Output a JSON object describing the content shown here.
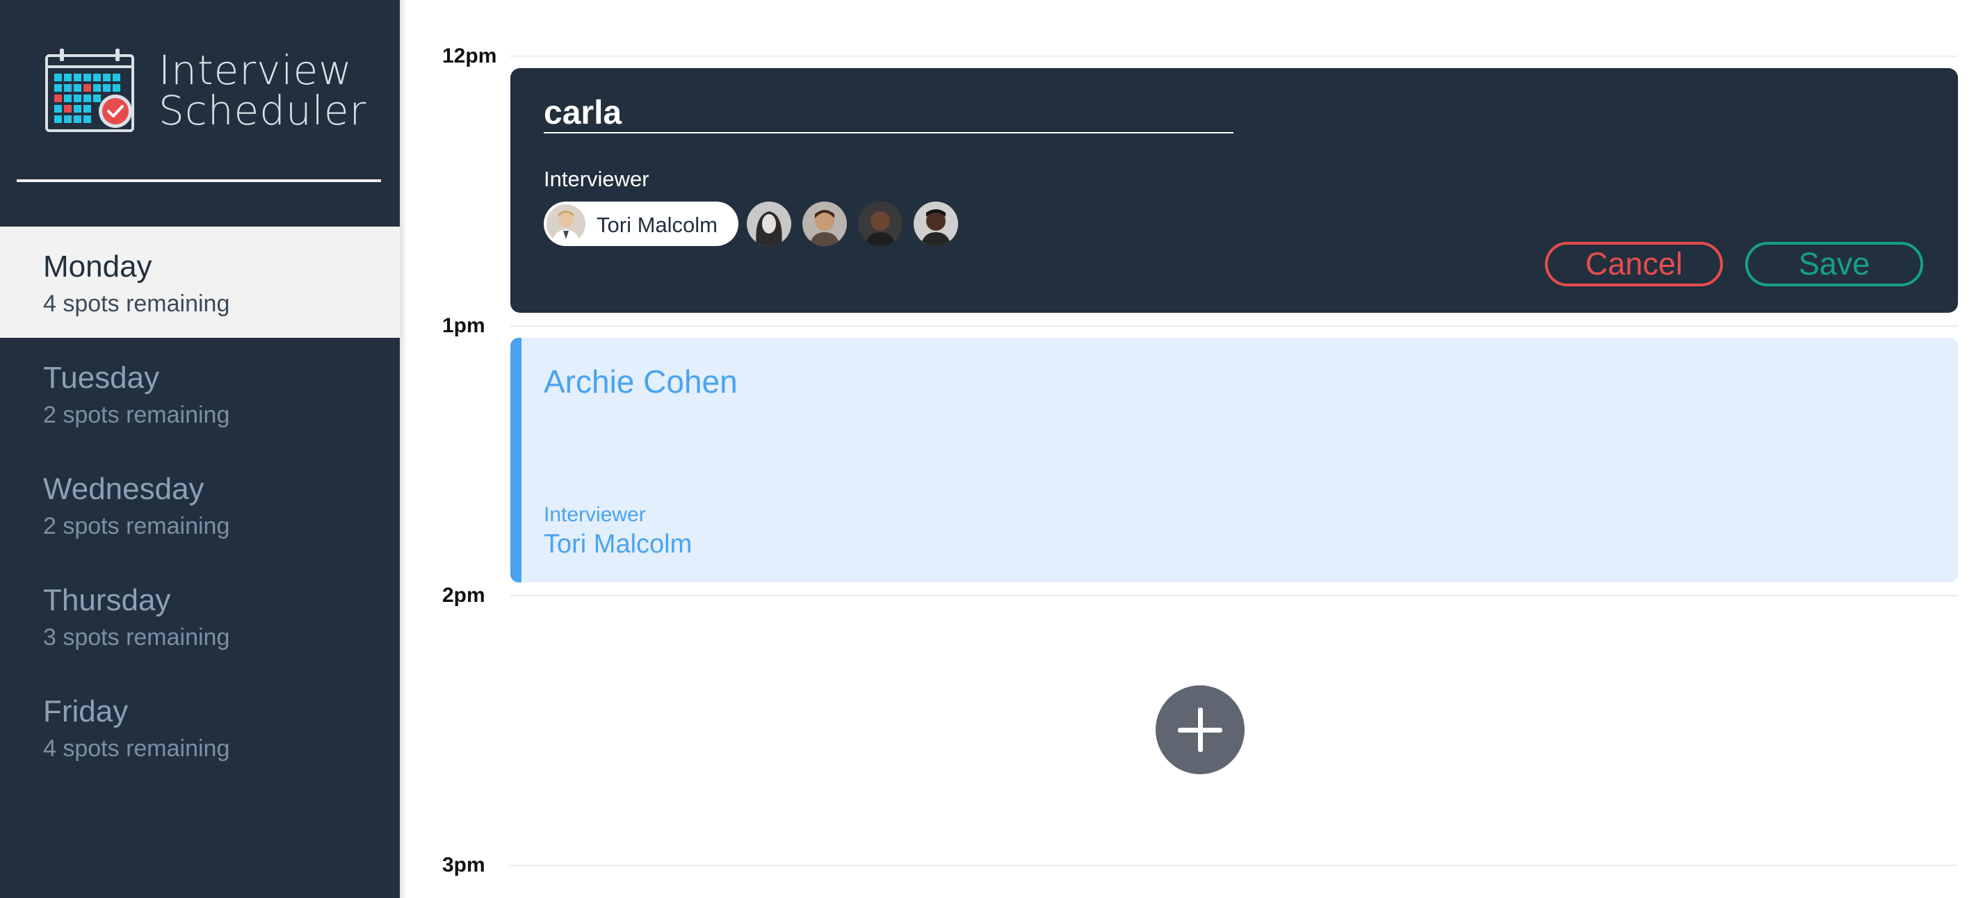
{
  "app": {
    "title_line1": "Interview",
    "title_line2": "Scheduler"
  },
  "sidebar": {
    "days": [
      {
        "name": "Monday",
        "spots": "4 spots remaining",
        "selected": true
      },
      {
        "name": "Tuesday",
        "spots": "2 spots remaining"
      },
      {
        "name": "Wednesday",
        "spots": "2 spots remaining"
      },
      {
        "name": "Thursday",
        "spots": "3 spots remaining"
      },
      {
        "name": "Friday",
        "spots": "4 spots remaining"
      }
    ]
  },
  "schedule": {
    "hours": [
      "12pm",
      "1pm",
      "2pm",
      "3pm"
    ],
    "edit_form": {
      "student_name_value": "carla",
      "interviewer_label": "Interviewer",
      "selected_interviewer": "Tori Malcolm",
      "other_interviewers": [
        "interviewer-avatar-2",
        "interviewer-avatar-3",
        "interviewer-avatar-4",
        "interviewer-avatar-5"
      ],
      "cancel_label": "Cancel",
      "save_label": "Save"
    },
    "booked": {
      "student": "Archie Cohen",
      "interviewer_label": "Interviewer",
      "interviewer": "Tori Malcolm"
    },
    "add_icon": "plus-icon"
  },
  "colors": {
    "sidebar_bg": "#222f3e",
    "selected_day_bg": "#f2f2f2",
    "booked_accent": "#4aa3f0",
    "booked_bg": "#e3effc",
    "cancel": "#e74c4c",
    "save": "#16a085",
    "add_button": "#5f6672"
  }
}
